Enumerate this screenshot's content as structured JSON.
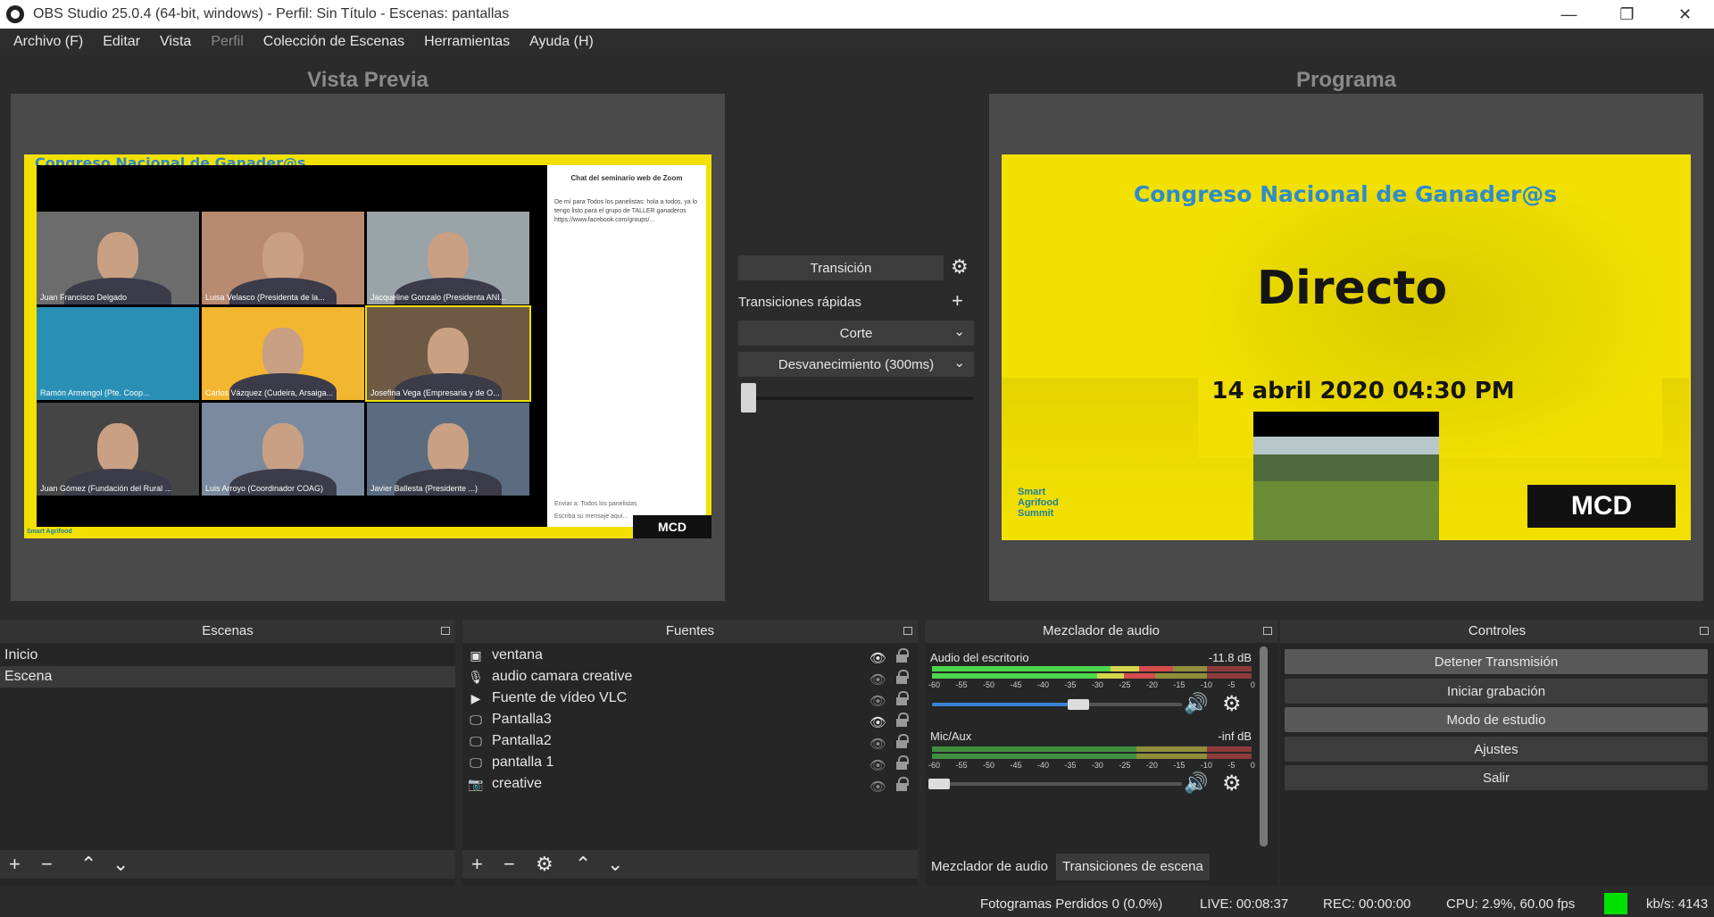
{
  "window": {
    "title": "OBS Studio 25.0.4 (64-bit, windows) - Perfil: Sin Título - Escenas: pantallas",
    "minimize": "—",
    "maximize": "❐",
    "close": "✕"
  },
  "menu": [
    "Archivo (F)",
    "Editar",
    "Vista",
    "Perfil",
    "Colección de Escenas",
    "Herramientas",
    "Ayuda (H)"
  ],
  "preview": {
    "heading": "Vista Previa",
    "banner": "Congreso Nacional de Ganader@s",
    "tiles": [
      "Juan Francisco Delgado",
      "Luisa Velasco (Presidenta de la...",
      "Jacqueline Gonzalo (Presidenta ANI...",
      "Ramón Armengol (Pte. Coop...",
      "Carlos Vázquez (Cudeira, Arsaiga...",
      "Josefina Vega (Empresaria y de O...",
      "Juan Gómez (Fundación del Rural ...",
      "Luis Arroyo (Coordinador COAG)",
      "Javier Ballesta (Presidente ...)"
    ],
    "chat_title": "Chat del seminario web de Zoom",
    "chat_msg": "De mí para Todos los panelistas: hola a todos, ya lo tengo listo para el grupo de TALLER ganaderos https://www.facebook.com/groups/...",
    "chat_to": "Enviar a:  Todos los panelistas",
    "chat_input": "Escriba su mensaje aquí...",
    "mcd": "MCD",
    "smart": "Smart Agrifood"
  },
  "program": {
    "heading": "Programa",
    "banner": "Congreso Nacional de Ganader@s",
    "main": "Directo",
    "date": "14 abril 2020 04:30 PM",
    "mcd": "MCD",
    "smart_line1": "Smart",
    "smart_line2": "Agrifood",
    "smart_line3": "Summit"
  },
  "transition": {
    "button": "Transición",
    "quick_label": "Transiciones rápidas",
    "quick1": "Corte",
    "quick2": "Desvanecimiento (300ms)"
  },
  "scenes": {
    "title": "Escenas",
    "items": [
      "Inicio",
      "Escena"
    ],
    "selected": "Escena"
  },
  "sources": {
    "title": "Fuentes",
    "items": [
      {
        "name": "ventana",
        "icon": "window-capture-icon",
        "visible": true
      },
      {
        "name": "audio camara creative",
        "icon": "microphone-icon",
        "visible": false
      },
      {
        "name": "Fuente de vídeo VLC",
        "icon": "play-icon",
        "visible": false
      },
      {
        "name": "Pantalla3",
        "icon": "monitor-icon",
        "visible": true
      },
      {
        "name": "Pantalla2",
        "icon": "monitor-icon",
        "visible": false
      },
      {
        "name": "pantalla 1",
        "icon": "monitor-icon",
        "visible": false
      },
      {
        "name": "creative",
        "icon": "camera-icon",
        "visible": false
      }
    ]
  },
  "mixer": {
    "title": "Mezclador de audio",
    "channels": [
      {
        "name": "Audio del escritorio",
        "db": "-11.8 dB",
        "volume": 0.61
      },
      {
        "name": "Mic/Aux",
        "db": "-inf dB",
        "volume": 0.0
      }
    ],
    "scale": [
      "-60",
      "-55",
      "-50",
      "-45",
      "-40",
      "-35",
      "-30",
      "-25",
      "-20",
      "-15",
      "-10",
      "-5",
      "0"
    ],
    "tab_mixer": "Mezclador de audio",
    "tab_transitions": "Transiciones de escena"
  },
  "controls": {
    "title": "Controles",
    "buttons": [
      "Detener Transmisión",
      "Iniciar grabación",
      "Modo de estudio",
      "Ajustes",
      "Salir"
    ]
  },
  "status": {
    "dropped": "Fotogramas Perdidos 0 (0.0%)",
    "live": "LIVE: 00:08:37",
    "rec": "REC: 00:00:00",
    "cpu": "CPU: 2.9%, 60.00 fps",
    "kbs": "kb/s: 4143",
    "live_color": "#00e000"
  },
  "colors": {
    "canvas_yellow": "#f2e100",
    "banner_blue": "#2e8ccc",
    "volume_blue": "#3b82d6"
  }
}
